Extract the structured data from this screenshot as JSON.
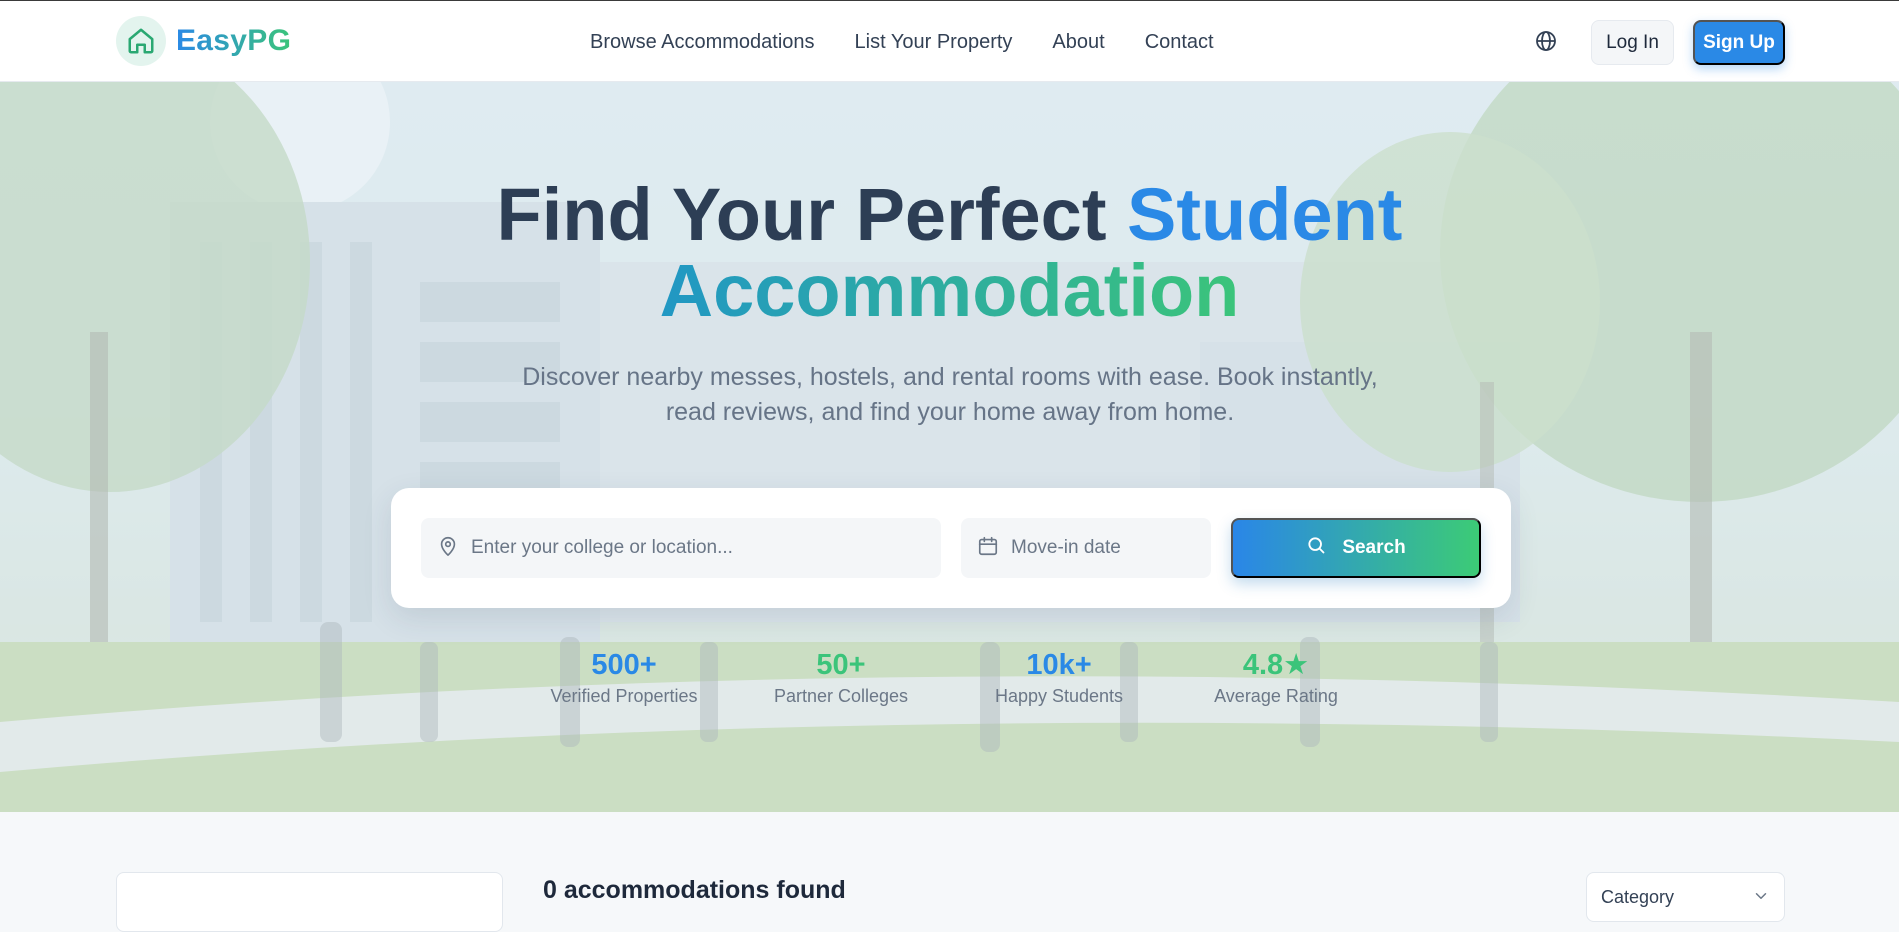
{
  "brand": {
    "name": "EasyPG",
    "icon": "home-icon",
    "gradient": [
      "#2a89e6",
      "#3bc47a"
    ]
  },
  "nav": {
    "links": [
      "Browse Accommodations",
      "List Your Property",
      "About",
      "Contact"
    ],
    "language_icon": "globe-icon",
    "login_label": "Log In",
    "signup_label": "Sign Up"
  },
  "hero": {
    "title_part1": "Find Your Perfect ",
    "title_part2": "Student",
    "title_part3": "Accommodation",
    "subtitle": "Discover nearby messes, hostels, and rental rooms with ease. Book instantly, read reviews, and find your home away from home."
  },
  "search": {
    "location_placeholder": "Enter your college or location...",
    "location_icon": "map-pin-icon",
    "date_placeholder": "Move-in date",
    "date_icon": "calendar-icon",
    "button_label": "Search",
    "button_icon": "search-icon"
  },
  "stats": [
    {
      "value": "500+",
      "label": "Verified Properties",
      "color": "#2a89e6"
    },
    {
      "value": "50+",
      "label": "Partner Colleges",
      "color": "#3bc47a"
    },
    {
      "value": "10k+",
      "label": "Happy Students",
      "color": "#2a89e6"
    },
    {
      "value": "4.8★",
      "label": "Average Rating",
      "color": "#3bc47a"
    }
  ],
  "results": {
    "count_text": "0 accommodations found",
    "category_label": "Category"
  },
  "colors": {
    "primary": "#2a89e6",
    "secondary": "#3bc47a",
    "text_dark": "#2d3e55"
  }
}
